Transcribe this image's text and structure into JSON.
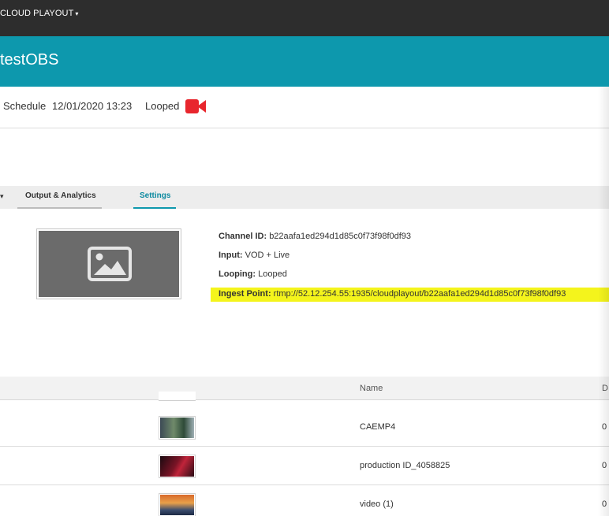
{
  "nav": {
    "menu_label": "CLOUD PLAYOUT",
    "menu_caret": "▾"
  },
  "header": {
    "title": "testOBS"
  },
  "info": {
    "schedule_label": "Schedule",
    "datetime": "12/01/2020 13:23",
    "mode": "Looped",
    "camera_icon": "video-camera-icon",
    "camera_color": "#e8262d"
  },
  "tabs": {
    "collapse_arrow": "▾",
    "items": [
      {
        "label": "Output & Analytics"
      },
      {
        "label": "Settings"
      }
    ],
    "active_color": "#0d98ad"
  },
  "details": {
    "channel_id_label": "Channel ID:",
    "channel_id": "b22aafa1ed294d1d85c0f73f98f0df93",
    "input_label": "Input:",
    "input": "VOD + Live",
    "looping_label": "Looping:",
    "looping": "Looped",
    "ingest_label": "Ingest Point:",
    "ingest": "rtmp://52.12.254.55:1935/cloudplayout/b22aafa1ed294d1d85c0f73f98f0df93"
  },
  "list": {
    "columns": {
      "name": "Name",
      "next": "D"
    },
    "rows": [
      {
        "name": "CAEMP4",
        "cut": "0"
      },
      {
        "name": "production ID_4058825",
        "cut": "0"
      },
      {
        "name": "video (1)",
        "cut": "0"
      }
    ]
  }
}
